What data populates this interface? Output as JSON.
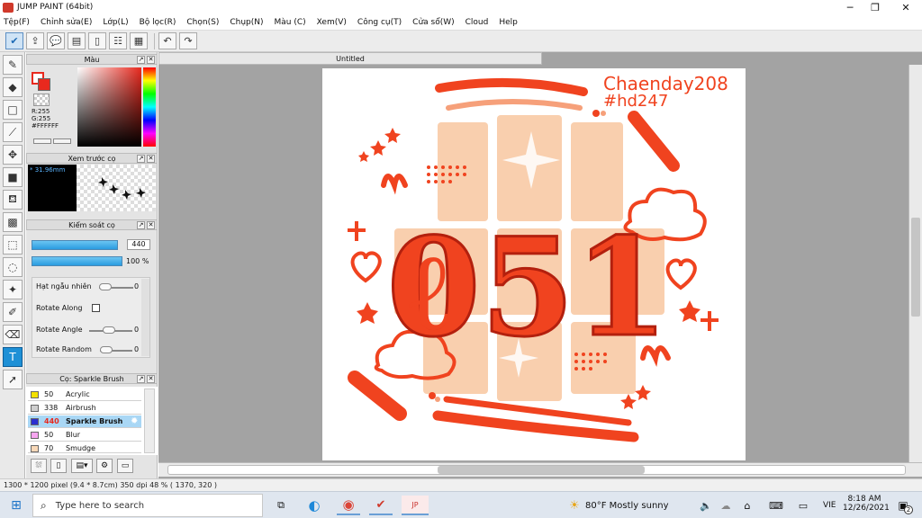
{
  "window": {
    "title": "JUMP PAINT (64bit)",
    "minimize": "─",
    "maximize": "❐",
    "close": "✕"
  },
  "menu": [
    "Tệp(F)",
    "Chỉnh sửa(E)",
    "Lớp(L)",
    "Bộ lọc(R)",
    "Chọn(S)",
    "Chụp(N)",
    "Màu (C)",
    "Xem(V)",
    "Công cụ(T)",
    "Cửa sổ(W)",
    "Cloud",
    "Help"
  ],
  "toolbar": {
    "icons": [
      "check-icon",
      "upload-icon",
      "speech-icon",
      "comment-icon",
      "document-icon",
      "panels-icon",
      "grid-icon",
      "undo-icon",
      "redo-icon"
    ]
  },
  "color_panel": {
    "title": "Màu",
    "r": "R:255",
    "g": "G:255",
    "hex": "#FFFFFF",
    "primary_color": "#e8291e",
    "secondary_color": "#ffffff"
  },
  "brush_preview": {
    "title": "Xem trước cọ",
    "size": "* 31.96mm"
  },
  "brush_control": {
    "title": "Kiểm soát cọ",
    "size_value": "440",
    "opacity_value": "100 %",
    "size_fraction": 0.95,
    "opacity_fraction": 1.0,
    "options": [
      {
        "label": "Hạt ngẫu nhiên",
        "value": "0"
      },
      {
        "label": "Rotate Along"
      },
      {
        "label": "Rotate Angle",
        "value": "0"
      },
      {
        "label": "Rotate Random",
        "value": "0"
      }
    ]
  },
  "brush_list": {
    "title": "Cọ: Sparkle Brush",
    "items": [
      {
        "size": "50",
        "name": "Acrylic",
        "color": "#f3e100"
      },
      {
        "size": "338",
        "name": "Airbrush",
        "color": "#cfcfcf"
      },
      {
        "size": "440",
        "name": "Sparkle Brush",
        "color": "#2a2fd0",
        "selected": true
      },
      {
        "size": "50",
        "name": "Blur",
        "color": "#f7a6f0"
      },
      {
        "size": "70",
        "name": "Smudge",
        "color": "#f8d8b8"
      }
    ]
  },
  "document": {
    "tab_title": "Untitled"
  },
  "artwork": {
    "text_line1": "Chaenday208",
    "text_line2": "#hd247",
    "number": "051",
    "accent": "#f0431f",
    "peach": "#f9cfae"
  },
  "status": {
    "text": "1300 * 1200 pixel  (9.4 * 8.7cm)  350 dpi  48 %  ( 1370, 320 )"
  },
  "taskbar": {
    "search_placeholder": "Type here to search",
    "weather": "80°F  Mostly sunny",
    "lang": "VIE",
    "time": "8:18 AM",
    "date": "12/26/2021",
    "notifications": "2"
  }
}
